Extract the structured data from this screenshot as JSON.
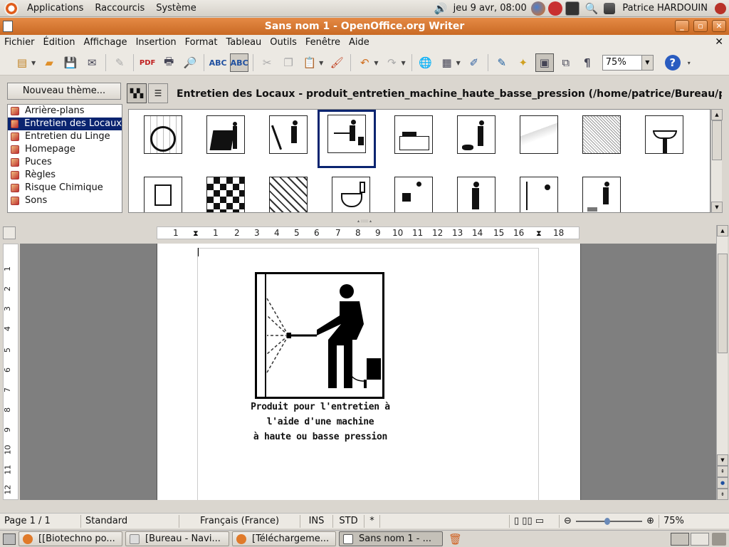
{
  "top_panel": {
    "menus": [
      "Applications",
      "Raccourcis",
      "Système"
    ],
    "clock": "jeu  9 avr, 08:00",
    "user": "Patrice HARDOUIN"
  },
  "window": {
    "title": "Sans nom 1 - OpenOffice.org Writer"
  },
  "menubar": [
    "Fichier",
    "Édition",
    "Affichage",
    "Insertion",
    "Format",
    "Tableau",
    "Outils",
    "Fenêtre",
    "Aide"
  ],
  "toolbar": {
    "zoom_value": "75%",
    "pilcrow": "¶",
    "help": "?"
  },
  "gallery": {
    "new_theme_button": "Nouveau thème...",
    "themes": [
      "Arrière-plans",
      "Entretien des Locaux",
      "Entretien du Linge",
      "Homepage",
      "Puces",
      "Règles",
      "Risque Chimique",
      "Sons"
    ],
    "selected_theme": "Entretien des Locaux",
    "title": "Entretien des Locaux - produit_entretien_machine_haute_basse_pression (/home/patrice/Bureau/pictos_e"
  },
  "ruler": {
    "h_numbers": [
      "1",
      "1",
      "2",
      "3",
      "4",
      "5",
      "6",
      "7",
      "8",
      "9",
      "10",
      "11",
      "12",
      "13",
      "14",
      "15",
      "16",
      "17",
      "18"
    ],
    "v_numbers": [
      "1",
      "2",
      "3",
      "4",
      "5",
      "6",
      "7",
      "8",
      "9",
      "10",
      "11",
      "12"
    ]
  },
  "document": {
    "caption_lines": [
      "Produit pour l'entretien à",
      "l'aide d'une machine",
      "à haute ou basse pression"
    ]
  },
  "statusbar": {
    "page": "Page 1 / 1",
    "style": "Standard",
    "language": "Français (France)",
    "insert_mode": "INS",
    "selection_mode": "STD",
    "modified": "*",
    "zoom": "75%"
  },
  "taskbar": {
    "tasks": [
      "[[Biotechno po...",
      "[Bureau - Navi...",
      "[Téléchargeme...",
      "Sans nom 1 - ..."
    ]
  }
}
